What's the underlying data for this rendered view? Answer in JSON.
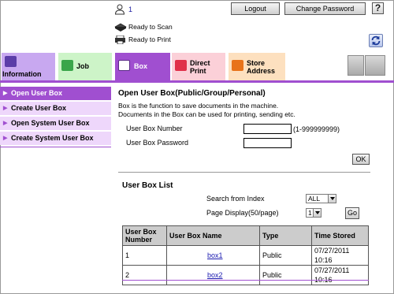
{
  "header": {
    "user_number": "1",
    "logout_label": "Logout",
    "change_password_label": "Change Password",
    "help_label": "?",
    "status_scan": "Ready to Scan",
    "status_print": "Ready to Print"
  },
  "tabs": [
    {
      "line1": "Information",
      "line2": ""
    },
    {
      "line1": "Job",
      "line2": ""
    },
    {
      "line1": "Box",
      "line2": ""
    },
    {
      "line1": "Direct",
      "line2": "Print"
    },
    {
      "line1": "Store",
      "line2": "Address"
    }
  ],
  "sidebar": {
    "items": [
      {
        "label": "Open User Box"
      },
      {
        "label": "Create User Box"
      },
      {
        "label": "Open System User Box"
      },
      {
        "label": "Create System User Box"
      }
    ]
  },
  "main": {
    "title": "Open User Box(Public/Group/Personal)",
    "description_line1": "Box is the function to save documents in the machine.",
    "description_line2": "Documents in the Box can be used for printing, sending etc.",
    "box_number_label": "User Box Number",
    "box_number_value": "",
    "box_number_range": "(1-999999999)",
    "box_password_label": "User Box Password",
    "box_password_value": "",
    "ok_label": "OK"
  },
  "list": {
    "title": "User Box List",
    "search_index_label": "Search from Index",
    "search_index_value": "ALL",
    "page_display_label": "Page Display(50/page)",
    "page_display_value": "1",
    "go_label": "Go",
    "columns": [
      "User Box Number",
      "User Box Name",
      "Type",
      "Time Stored"
    ],
    "rows": [
      {
        "number": "1",
        "name": "box1",
        "type": "Public",
        "time": "07/27/2011 10:16"
      },
      {
        "number": "2",
        "name": "box2",
        "type": "Public",
        "time": "07/27/2011 10:16"
      }
    ]
  },
  "colors": {
    "box_tab": "#a04fd0",
    "sidebar_active": "#a04fd0",
    "sidebar_inactive": "#eed7fb",
    "info_tab": "#c8a8f0",
    "job_tab": "#cdf4c8",
    "direct_print_tab": "#fbd0d8",
    "store_address_tab": "#fde0bf"
  }
}
